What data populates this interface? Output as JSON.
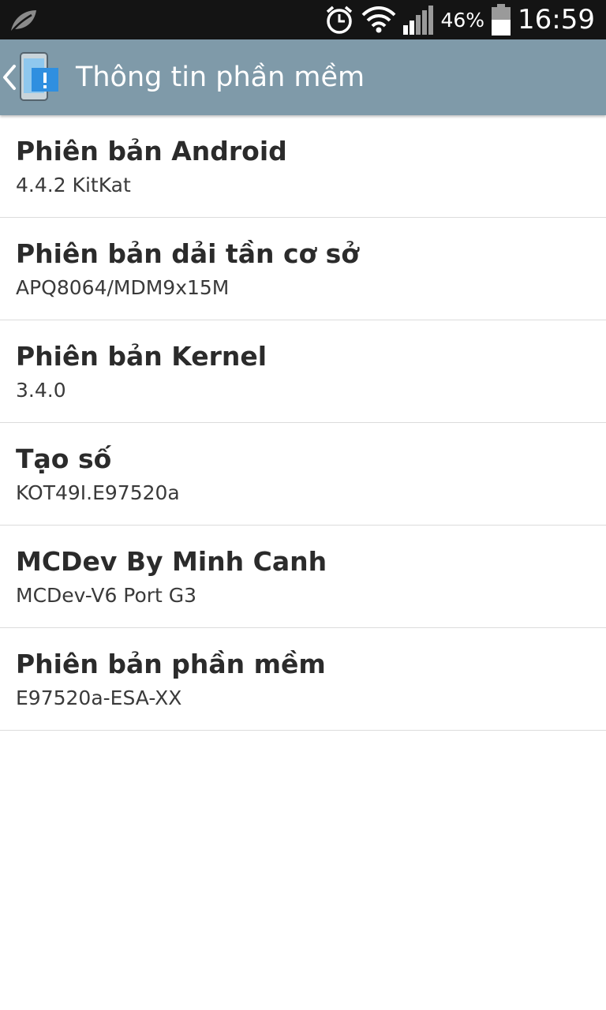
{
  "status_bar": {
    "battery_percent": "46%",
    "time": "16:59",
    "icons": [
      "leaf-icon",
      "alarm-icon",
      "wifi-icon",
      "signal-icon",
      "battery-icon"
    ]
  },
  "action_bar": {
    "title": "Thông tin phần mềm",
    "color": "#7f9aa9"
  },
  "items": [
    {
      "title": "Phiên bản Android",
      "value": "4.4.2 KitKat"
    },
    {
      "title": "Phiên bản dải tần cơ sở",
      "value": "APQ8064/MDM9x15M"
    },
    {
      "title": "Phiên bản Kernel",
      "value": "3.4.0"
    },
    {
      "title": "Tạo số",
      "value": "KOT49I.E97520a"
    },
    {
      "title": "MCDev By Minh Canh",
      "value": "MCDev-V6 Port G3"
    },
    {
      "title": "Phiên bản phần mềm",
      "value": "E97520a-ESA-XX"
    }
  ]
}
